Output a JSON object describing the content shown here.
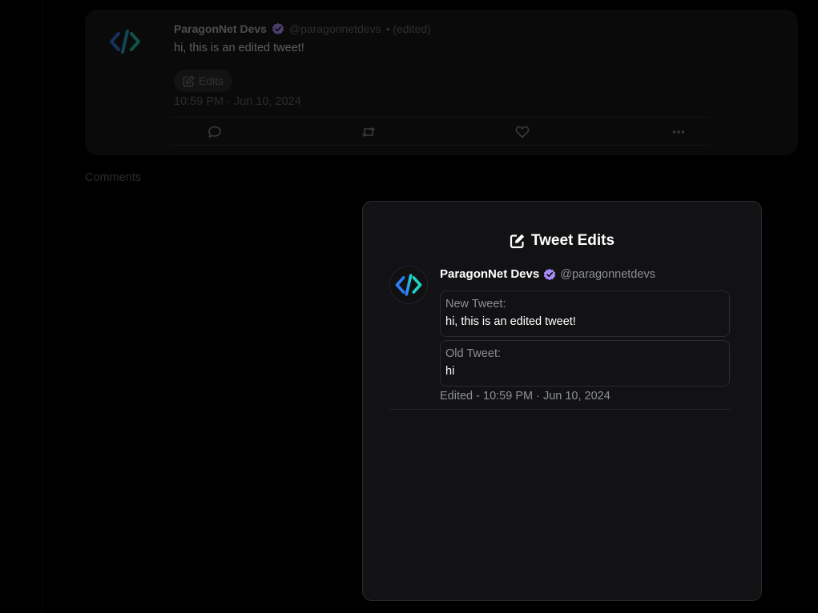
{
  "tweet": {
    "author_name": "ParagonNet Devs",
    "handle": "@paragonnetdevs",
    "edited_suffix": "• (edited)",
    "text": "hi, this is an edited tweet!",
    "edits_label": "Edits",
    "timestamp": "10:59 PM · Jun 10, 2024"
  },
  "comments_label": "Comments",
  "modal": {
    "title": "Tweet Edits",
    "author_name": "ParagonNet Devs",
    "handle": "@paragonnetdevs",
    "new_label": "New Tweet:",
    "new_text": "hi, this is an edited tweet!",
    "old_label": "Old Tweet:",
    "old_text": "hi",
    "edited_timestamp": "Edited - 10:59 PM · Jun 10, 2024"
  },
  "colors": {
    "verified_badge": "#a78bfa",
    "logo_left": "#2f7df6",
    "logo_right": "#22d3c5"
  }
}
